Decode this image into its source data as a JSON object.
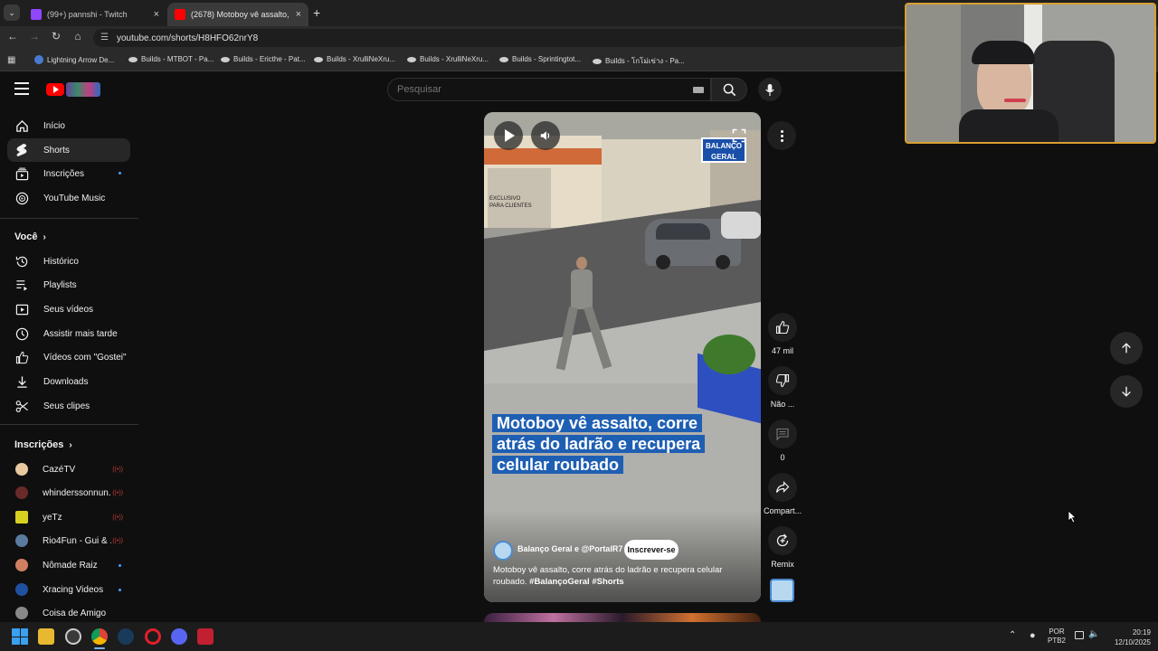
{
  "browser": {
    "tabs": [
      {
        "title": "(99+) pannshi - Twitch",
        "close": "×"
      },
      {
        "title": "(2678) Motoboy vê assalto, cor",
        "close": "×"
      }
    ],
    "new_tab": "+",
    "url": "youtube.com/shorts/H8HFO62nrY8",
    "bookmarks": [
      "Lightning Arrow De...",
      "Builds - MTBOT - Pa...",
      "Builds - Ericthe - Pat...",
      "Builds - XrulliNeXru...",
      "Builds - XrulliNeXru...",
      "Builds - Sprintingtot...",
      "Builds - โกโม่เข่าง - Pa..."
    ]
  },
  "header": {
    "search_placeholder": "Pesquisar"
  },
  "sidebar": {
    "main": [
      {
        "label": "Início",
        "icon": "home-icon"
      },
      {
        "label": "Shorts",
        "icon": "shorts-icon"
      },
      {
        "label": "Inscrições",
        "icon": "subscriptions-icon"
      },
      {
        "label": "YouTube Music",
        "icon": "music-icon"
      }
    ],
    "you_title": "Você",
    "you": [
      {
        "label": "Histórico",
        "icon": "history-icon"
      },
      {
        "label": "Playlists",
        "icon": "playlists-icon"
      },
      {
        "label": "Seus vídeos",
        "icon": "your-videos-icon"
      },
      {
        "label": "Assistir mais tarde",
        "icon": "watch-later-icon"
      },
      {
        "label": "Vídeos com \"Gostei\"",
        "icon": "liked-icon"
      },
      {
        "label": "Downloads",
        "icon": "downloads-icon"
      },
      {
        "label": "Seus clipes",
        "icon": "clips-icon"
      }
    ],
    "subs_title": "Inscrições",
    "subscriptions": [
      {
        "name": "CazéTV",
        "status": "live",
        "color": "#e8c9a0"
      },
      {
        "name": "whinderssonnun...",
        "status": "live",
        "color": "#6a2a2a"
      },
      {
        "name": "yeTz",
        "status": "live",
        "color": "#d8d020"
      },
      {
        "name": "Rio4Fun - Gui & ...",
        "status": "live",
        "color": "#5a7aa0"
      },
      {
        "name": "Nômade Raiz",
        "status": "new",
        "color": "#d08060"
      },
      {
        "name": "Xracing Videos",
        "status": "new",
        "color": "#2050a0"
      },
      {
        "name": "Coisa de Amigo",
        "status": "none",
        "color": "#888888"
      }
    ]
  },
  "short": {
    "caption_line1": "Motoboy vê assalto, corre",
    "caption_line2": "atrás do ladrão e recupera",
    "caption_line3": "celular roubado",
    "channel": "Balanço Geral e @PortalR7",
    "subscribe": "Inscrever-se",
    "description": "Motoboy vê assalto, corre atrás do ladrão e recupera celular roubado.",
    "hashtags": "#BalançoGeral #Shorts",
    "sign_text": "BALANÇO GERAL",
    "shop_text_1": "EXCLUSIVO",
    "shop_text_2": "PARA CLIENTES"
  },
  "actions": {
    "likes": "47 mil",
    "dislike": "Não ...",
    "comments": "0",
    "share": "Compart...",
    "remix": "Remix"
  },
  "taskbar": {
    "lang1": "POR",
    "lang2": "PTB2",
    "time": "20:19",
    "date": "12/10/2025"
  },
  "colors": {
    "brand_red": "#ff0000",
    "caption_bg": "#1e5fb3",
    "live_red": "#c43a3a",
    "accent_blue": "#3ea6ff"
  }
}
